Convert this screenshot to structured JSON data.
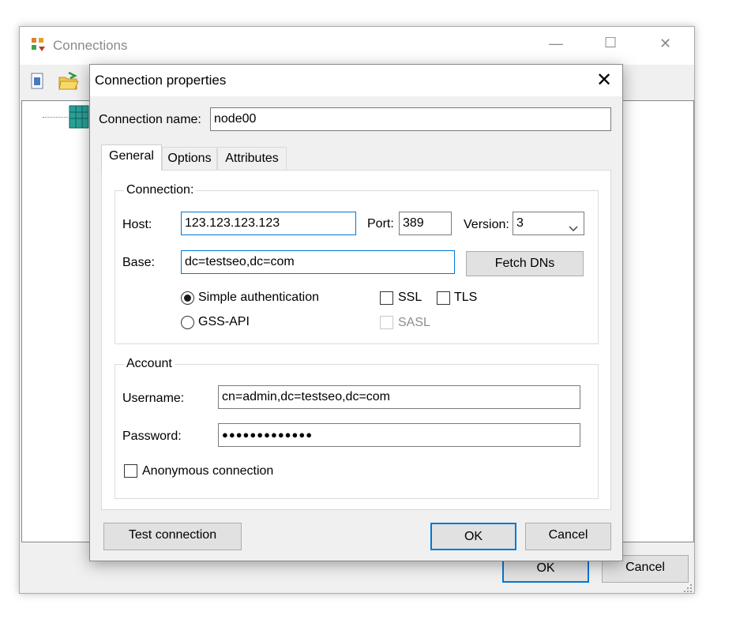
{
  "bg_window": {
    "title": "Connections",
    "minimize": "—",
    "maximize": "☐",
    "close": "✕",
    "ok_label": "OK",
    "cancel_label": "Cancel"
  },
  "dialog": {
    "title": "Connection properties",
    "close": "✕",
    "connection_name_label": "Connection name:",
    "connection_name_value": "node00",
    "tabs": [
      {
        "label": "General",
        "active": true
      },
      {
        "label": "Options",
        "active": false
      },
      {
        "label": "Attributes",
        "active": false
      }
    ],
    "connection_group": {
      "legend": "Connection:",
      "host_label": "Host:",
      "host_value": "123.123.123.123",
      "port_label": "Port:",
      "port_value": "389",
      "version_label": "Version:",
      "version_value": "3",
      "base_label": "Base:",
      "base_value": "dc=testseo,dc=com",
      "fetch_dns_label": "Fetch DNs",
      "simple_auth_label": "Simple authentication",
      "gss_api_label": "GSS-API",
      "ssl_label": "SSL",
      "tls_label": "TLS",
      "sasl_label": "SASL"
    },
    "account_group": {
      "legend": "Account",
      "username_label": "Username:",
      "username_value": "cn=admin,dc=testseo,dc=com",
      "password_label": "Password:",
      "password_value": "●●●●●●●●●●●●●",
      "anonymous_label": "Anonymous connection"
    },
    "test_connection_label": "Test connection",
    "ok_label": "OK",
    "cancel_label": "Cancel"
  }
}
